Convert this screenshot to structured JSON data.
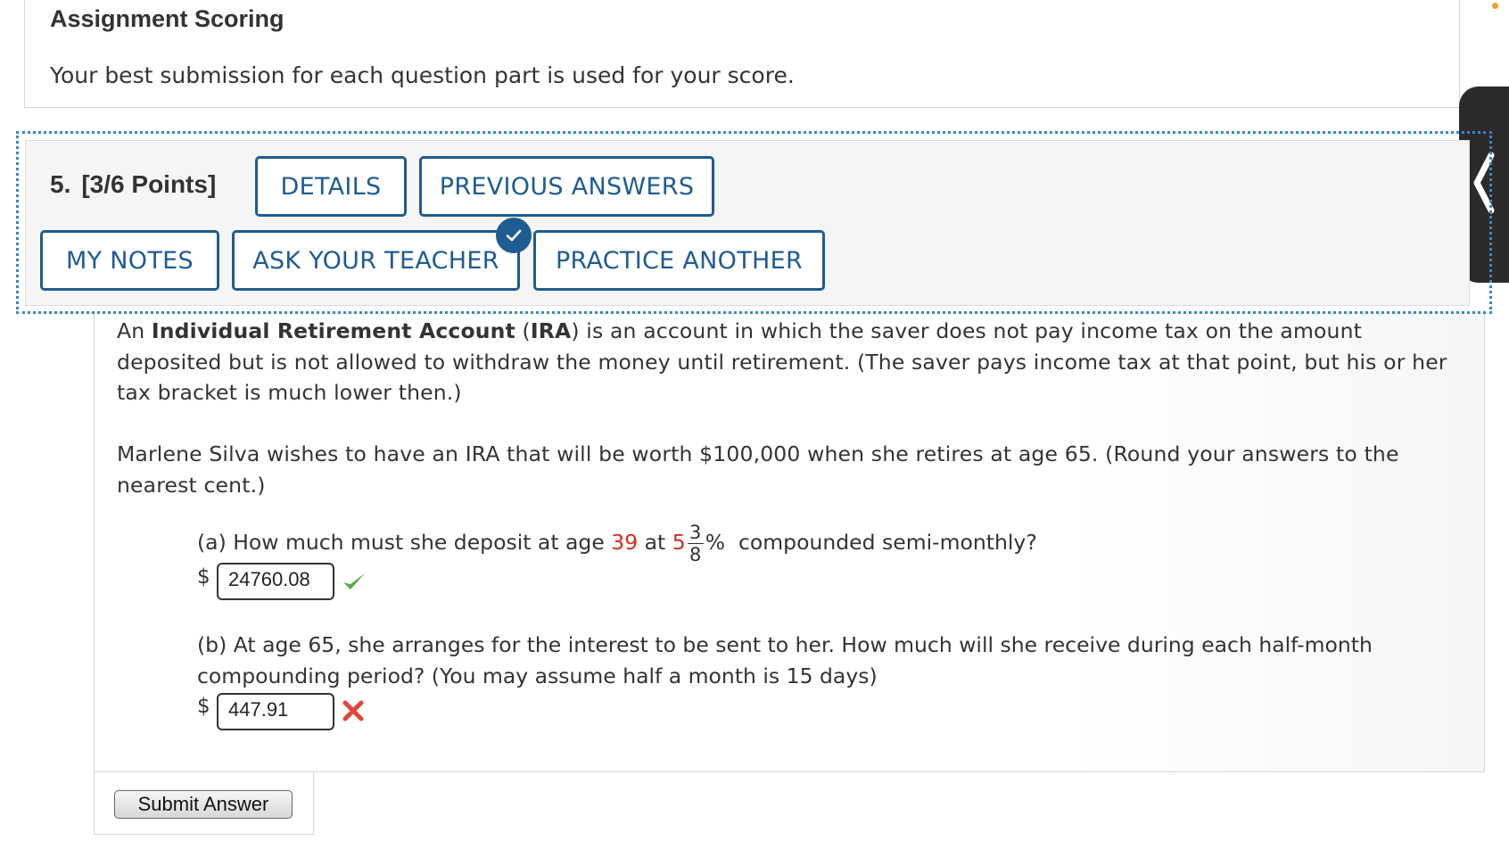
{
  "scoring": {
    "title": "Assignment Scoring",
    "description": "Your best submission for each question part is used for your score."
  },
  "question": {
    "number": "5.",
    "points": "[3/6 Points]",
    "buttons": {
      "details": "DETAILS",
      "previous_answers": "PREVIOUS ANSWERS",
      "my_notes": "MY NOTES",
      "ask_your_teacher": "ASK YOUR TEACHER",
      "practice_another": "PRACTICE ANOTHER"
    }
  },
  "content": {
    "para1": {
      "intro": "An ",
      "term_bold": "Individual Retirement Account",
      "paren_open": " (",
      "abbr_bold": "IRA",
      "rest": ") is an account in which the saver does not pay income tax on the amount deposited but is not allowed to withdraw the money until retirement. (The saver pays income tax at that point, but his or her tax bracket is much lower then.)"
    },
    "para2": "Marlene Silva wishes to have an IRA that will be worth $100,000 when she retires at age 65. (Round your answers to the nearest cent.)",
    "part_a": {
      "prefix": "(a) How much must she deposit at age ",
      "age": "39",
      "at": " at ",
      "rate_whole": "5",
      "rate_num": "3",
      "rate_den": "8",
      "percent": "%",
      "suffix": "  compounded semi-monthly?",
      "currency": "$",
      "answer": "24760.08",
      "status": "correct"
    },
    "part_b": {
      "question": "(b) At age 65, she arranges for the interest to be sent to her. How much will she receive during each half-month compounding period? (You may assume half a month is 15 days)",
      "currency": "$",
      "answer": "447.91",
      "status": "incorrect"
    }
  },
  "submit": {
    "label": "Submit Answer"
  },
  "colors": {
    "button_blue": "#1f5c91",
    "highlight_red": "#d52b1e",
    "correct_green": "#5aa84a",
    "incorrect_red": "#e0453a",
    "focus_dotted": "#3a86c8"
  },
  "icons": {
    "check_badge": "check-icon",
    "correct": "checkmark-icon",
    "incorrect": "x-mark-icon",
    "side_handle": "chevron-left-icon"
  }
}
